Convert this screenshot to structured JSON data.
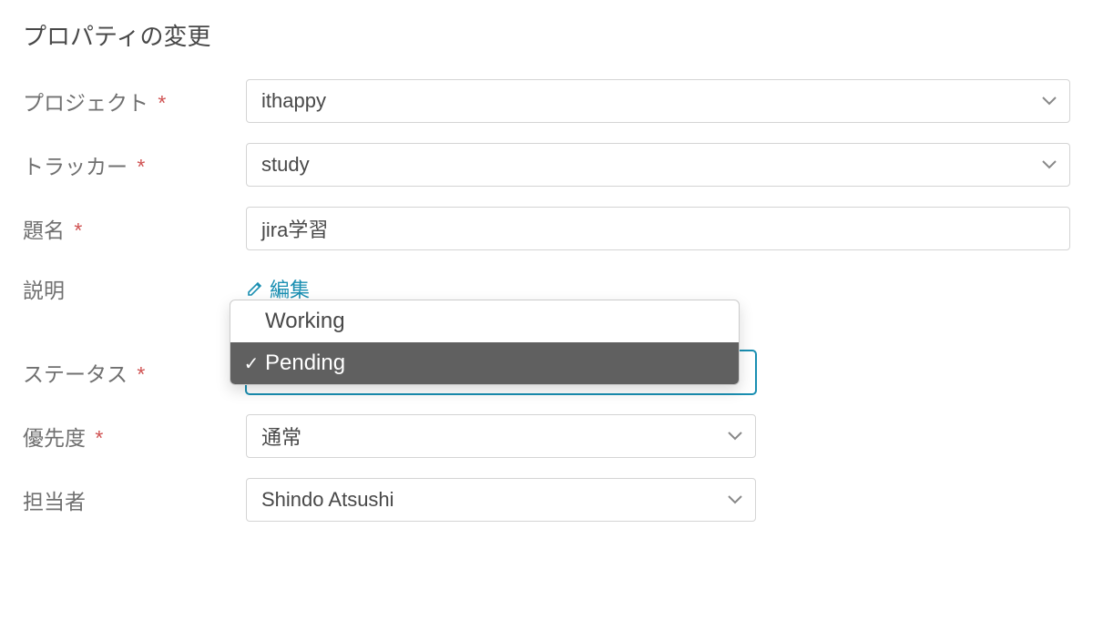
{
  "form": {
    "title": "プロパティの変更",
    "required_mark": "*",
    "fields": {
      "project": {
        "label": "プロジェクト",
        "value": "ithappy"
      },
      "tracker": {
        "label": "トラッカー",
        "value": "study"
      },
      "subject": {
        "label": "題名",
        "value": "jira学習"
      },
      "description": {
        "label": "説明",
        "edit_label": "編集"
      },
      "status": {
        "label": "ステータス",
        "value": "Pending",
        "options": [
          {
            "label": "Working",
            "selected": false
          },
          {
            "label": "Pending",
            "selected": true
          }
        ]
      },
      "priority": {
        "label": "優先度",
        "value": "通常"
      },
      "assignee": {
        "label": "担当者",
        "value": "Shindo Atsushi"
      }
    }
  },
  "colors": {
    "accent": "#1a8fb2",
    "required": "#d05353",
    "dropdown_selected_bg": "#606060"
  }
}
